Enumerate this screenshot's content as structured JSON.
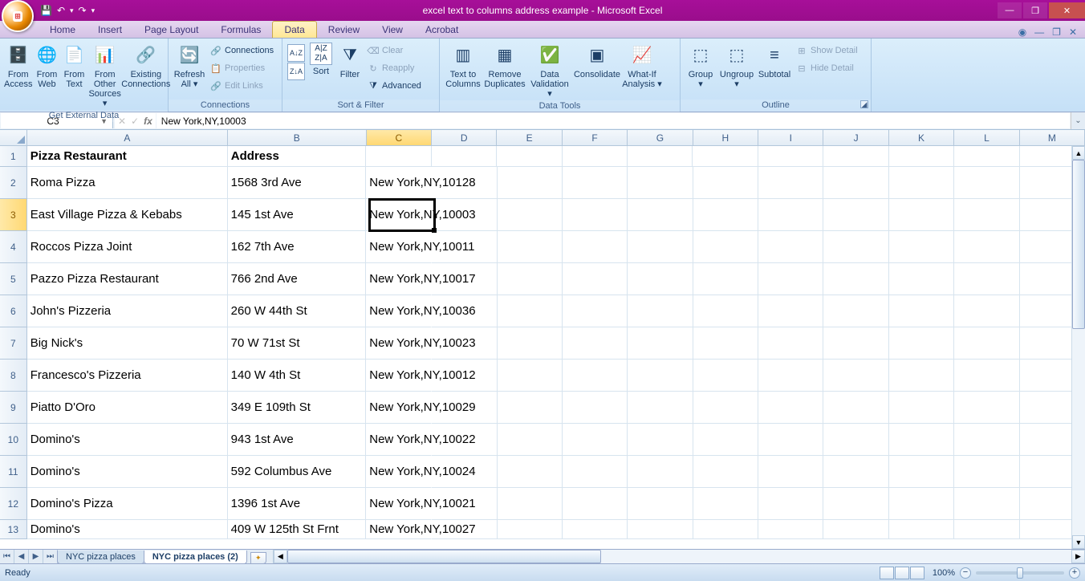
{
  "title": "excel text to columns address example - Microsoft Excel",
  "qat": {
    "save": "💾",
    "undo": "↶",
    "redo": "↷"
  },
  "tabs": [
    "Home",
    "Insert",
    "Page Layout",
    "Formulas",
    "Data",
    "Review",
    "View",
    "Acrobat"
  ],
  "active_tab": "Data",
  "ribbon": {
    "get_external": {
      "title": "Get External Data",
      "from_access": "From\nAccess",
      "from_web": "From\nWeb",
      "from_text": "From\nText",
      "from_other": "From Other\nSources ▾",
      "existing": "Existing\nConnections"
    },
    "connections": {
      "title": "Connections",
      "refresh": "Refresh\nAll ▾",
      "connections": "Connections",
      "properties": "Properties",
      "edit_links": "Edit Links"
    },
    "sort_filter": {
      "title": "Sort & Filter",
      "sort": "Sort",
      "filter": "Filter",
      "clear": "Clear",
      "reapply": "Reapply",
      "advanced": "Advanced"
    },
    "data_tools": {
      "title": "Data Tools",
      "ttc": "Text to\nColumns",
      "remove_dup": "Remove\nDuplicates",
      "validation": "Data\nValidation ▾",
      "consolidate": "Consolidate",
      "whatif": "What-If\nAnalysis ▾"
    },
    "outline": {
      "title": "Outline",
      "group": "Group\n▾",
      "ungroup": "Ungroup\n▾",
      "subtotal": "Subtotal",
      "show_detail": "Show Detail",
      "hide_detail": "Hide Detail"
    }
  },
  "namebox": "C3",
  "formula": "New York,NY,10003",
  "columns": [
    "A",
    "B",
    "C",
    "D",
    "E",
    "F",
    "G",
    "H",
    "I",
    "J",
    "K",
    "L",
    "M"
  ],
  "active_col": "C",
  "active_row": 3,
  "headers": {
    "A": "Pizza Restaurant",
    "B": "Address"
  },
  "rows": [
    {
      "n": 2,
      "A": "Roma Pizza",
      "B": "1568 3rd Ave",
      "C": "New York,NY,10128"
    },
    {
      "n": 3,
      "A": "East Village Pizza & Kebabs",
      "B": "145 1st Ave",
      "C": "New York,NY,10003"
    },
    {
      "n": 4,
      "A": "Roccos Pizza Joint",
      "B": "162 7th Ave",
      "C": "New York,NY,10011"
    },
    {
      "n": 5,
      "A": "Pazzo Pizza Restaurant",
      "B": "766 2nd Ave",
      "C": "New York,NY,10017"
    },
    {
      "n": 6,
      "A": "John's Pizzeria",
      "B": "260 W 44th St",
      "C": "New York,NY,10036"
    },
    {
      "n": 7,
      "A": "Big Nick's",
      "B": "70 W 71st St",
      "C": "New York,NY,10023"
    },
    {
      "n": 8,
      "A": "Francesco's Pizzeria",
      "B": "140 W 4th St",
      "C": "New York,NY,10012"
    },
    {
      "n": 9,
      "A": "Piatto D'Oro",
      "B": "349 E 109th St",
      "C": "New York,NY,10029"
    },
    {
      "n": 10,
      "A": "Domino's",
      "B": "943 1st Ave",
      "C": "New York,NY,10022"
    },
    {
      "n": 11,
      "A": "Domino's",
      "B": "592 Columbus Ave",
      "C": "New York,NY,10024"
    },
    {
      "n": 12,
      "A": "Domino's Pizza",
      "B": "1396 1st Ave",
      "C": "New York,NY,10021"
    },
    {
      "n": 13,
      "A": "Domino's",
      "B": "409 W 125th St Frnt",
      "C": "New York,NY,10027"
    }
  ],
  "sheets": [
    "NYC pizza places",
    "NYC pizza places (2)"
  ],
  "active_sheet": 1,
  "status": "Ready",
  "zoom": "100%"
}
